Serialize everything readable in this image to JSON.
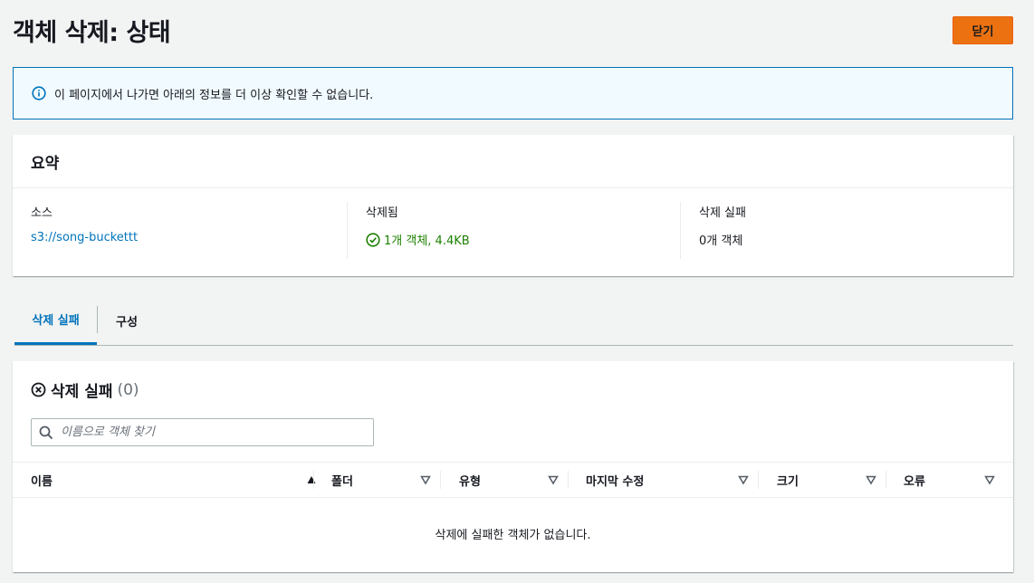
{
  "page": {
    "title": "객체 삭제: 상태",
    "close_label": "닫기"
  },
  "alert": {
    "icon": "info-icon",
    "text": "이 페이지에서 나가면 아래의 정보를 더 이상 확인할 수 없습니다."
  },
  "summary": {
    "title": "요약",
    "source_label": "소스",
    "source_value": "s3://song-buckettt",
    "deleted_label": "삭제됨",
    "deleted_value": "1개 객체, 4.4KB",
    "failed_label": "삭제 실패",
    "failed_value": "0개 객체"
  },
  "tabs": [
    {
      "label": "삭제 실패",
      "active": true
    },
    {
      "label": "구성",
      "active": false
    }
  ],
  "failed_section": {
    "title": "삭제 실패",
    "count": "(0)",
    "search_placeholder": "이름으로 객체 찾기",
    "columns": [
      "이름",
      "폴더",
      "유형",
      "마지막 수정",
      "크기",
      "오류"
    ],
    "empty_message": "삭제에 실패한 객체가 없습니다."
  },
  "colors": {
    "primary": "#ec7211",
    "link": "#0073bb",
    "success": "#1d8102",
    "info_bg": "#f1faff"
  }
}
